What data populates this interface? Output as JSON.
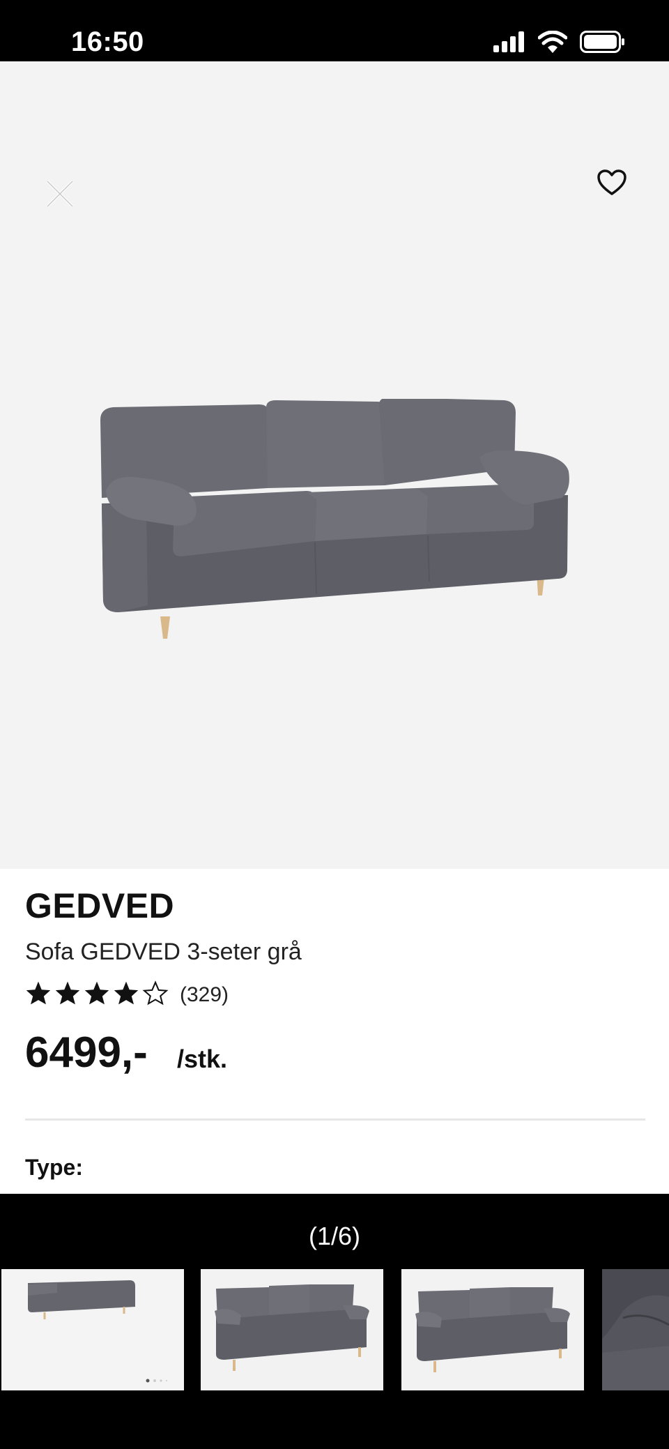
{
  "status_bar": {
    "time": "16:50"
  },
  "product": {
    "brand": "GEDVED",
    "name": "Sofa GEDVED 3-seter grå",
    "rating": 4,
    "rating_max": 5,
    "review_count": "(329)",
    "price": "6499,-",
    "unit": "/stk.",
    "type_label": "Type:"
  },
  "gallery": {
    "counter": "(1/6)",
    "current_index": 1,
    "total": 6
  },
  "colors": {
    "image_background": "#f3f3f3",
    "sofa_fabric": "#5f6068",
    "wood_legs": "#d9b98a"
  }
}
